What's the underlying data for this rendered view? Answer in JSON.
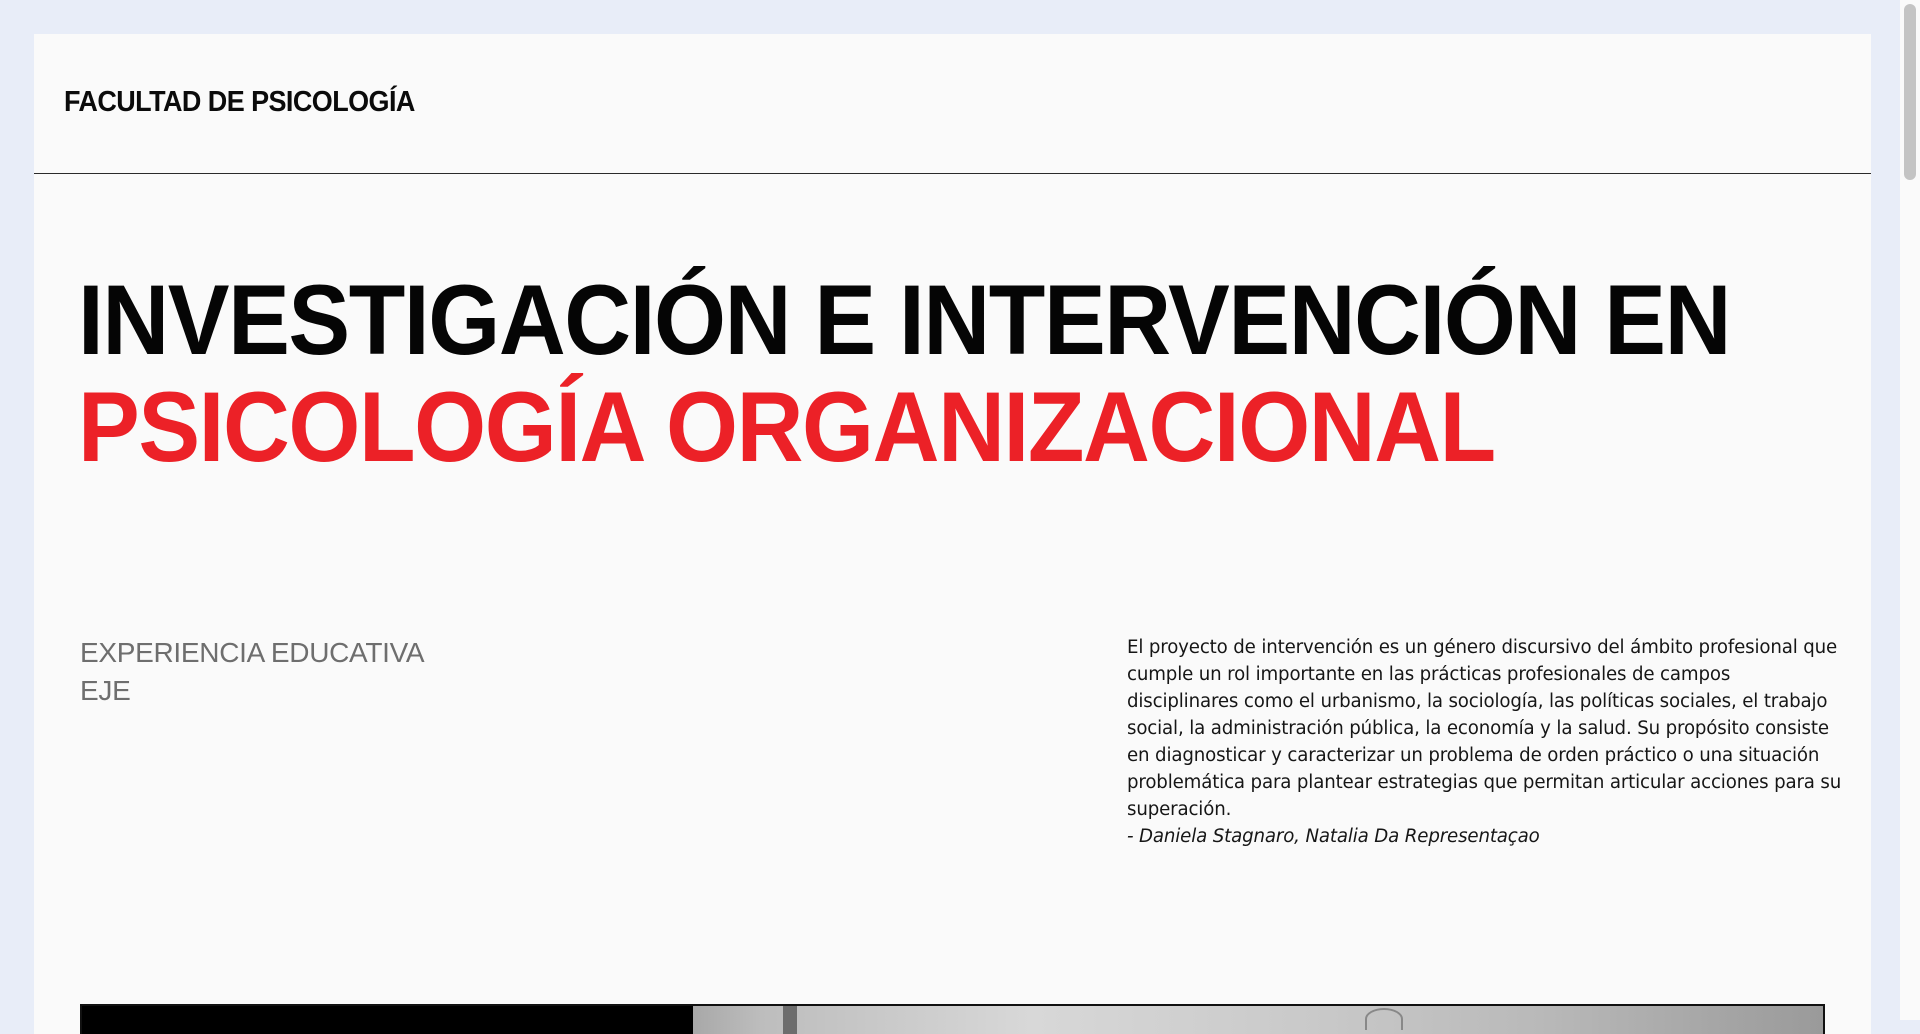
{
  "header": {
    "site_title": "FACULTAD DE PSICOLOGÍA"
  },
  "hero": {
    "title_line_1": "INVESTIGACIÓN E INTERVENCIÓN EN",
    "title_line_2": "PSICOLOGÍA ORGANIZACIONAL",
    "accent_color": "#ec2127"
  },
  "meta": {
    "label_1": "EXPERIENCIA EDUCATIVA",
    "label_2": "EJE"
  },
  "description": {
    "text": "El proyecto de intervención es un género discursivo del ámbito profesional que cumple un rol importante en las prácticas profesionales de campos disciplinares como el urbanismo, la sociología, las políticas sociales, el trabajo social, la administración pública, la economía y la salud. Su propósito consiste en diagnosticar y caracterizar un problema de orden práctico o una situación problemática para plantear estrategias que permitan articular acciones para su superación.",
    "author": "- Daniela Stagnaro, Natalia Da Representaçao"
  }
}
